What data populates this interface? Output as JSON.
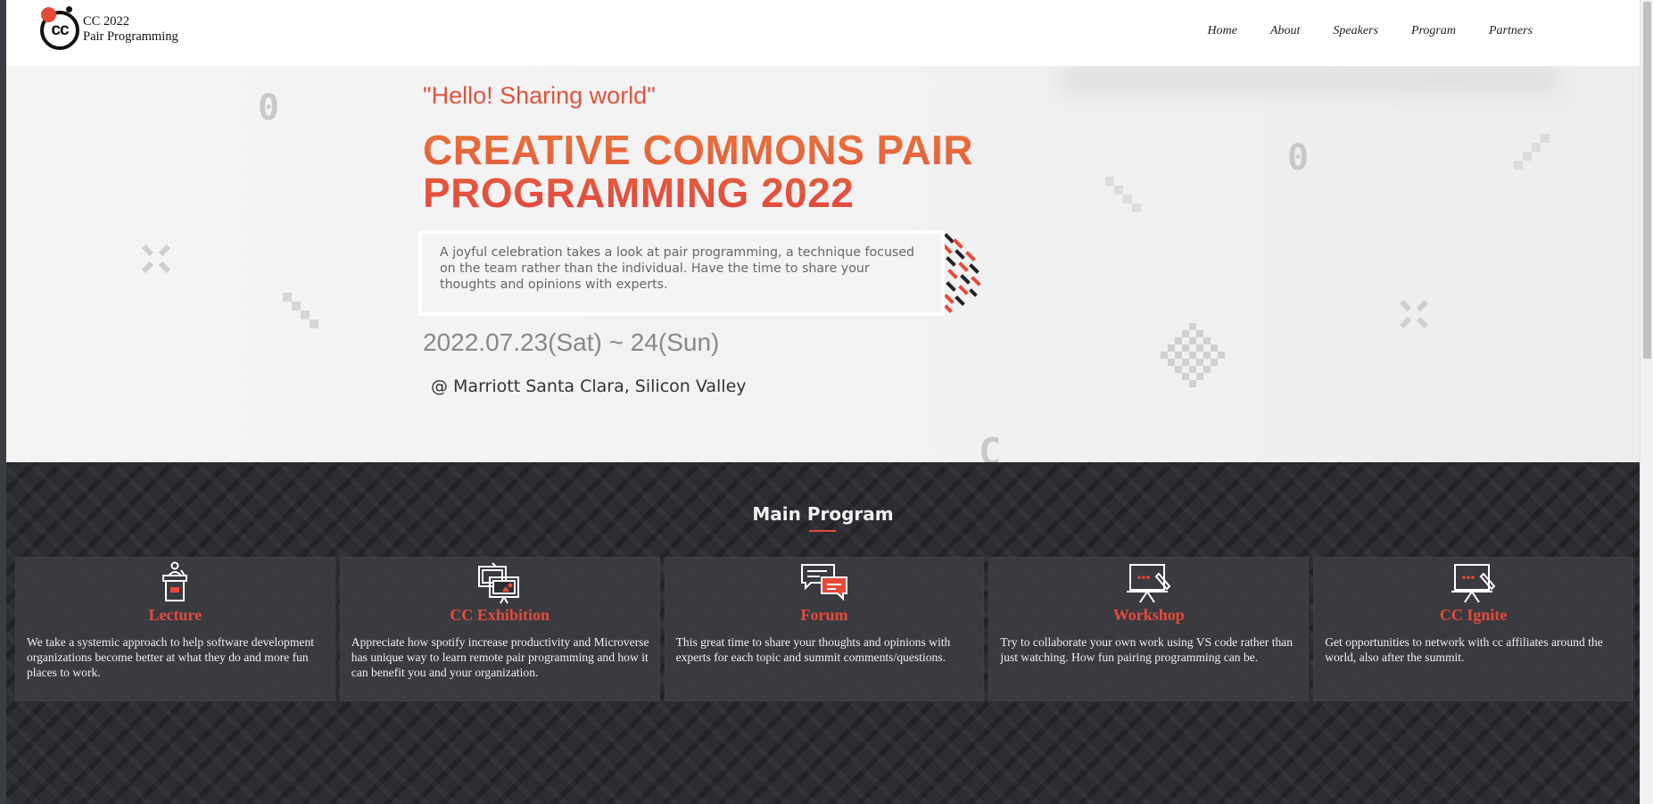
{
  "brand": {
    "line1": "CC 2022",
    "line2": "Pair Programming",
    "logo_text": "cc"
  },
  "nav": {
    "items": [
      "Home",
      "About",
      "Speakers",
      "Program",
      "Partners"
    ]
  },
  "hero": {
    "tagline": "\"Hello! Sharing world\"",
    "title_line1": "CREATIVE COMMONS PAIR",
    "title_line2": "PROGRAMMING 2022",
    "description": "A joyful celebration takes a look at pair programming, a technique focused on the team rather than the individual. Have the time to share your thoughts and opinions with experts.",
    "date": "2022.07.23(Sat) ~ 24(Sun)",
    "venue": "@ Marriott Santa Clara, Silicon Valley"
  },
  "program": {
    "title": "Main Program",
    "cards": [
      {
        "title": "Lecture",
        "text": "We take a systemic approach to help software development organizations become better at what they do and more fun places to work.",
        "icon": "podium-icon"
      },
      {
        "title": "CC Exhibition",
        "text": "Appreciate how spotify increase productivity and Microverse has unique way to learn remote pair programming and how it can benefit you and your organization.",
        "icon": "exhibition-boards-icon"
      },
      {
        "title": "Forum",
        "text": "This great time to share your thoughts and opinions with experts for each topic and summit comments/questions.",
        "icon": "chat-bubbles-icon"
      },
      {
        "title": "Workshop",
        "text": "Try to collaborate your own work using VS code rather than just watching. How fun pairing programming can be.",
        "icon": "easel-pen-icon"
      },
      {
        "title": "CC Ignite",
        "text": "Get opportunities to network with cc affiliates around the world, also after the summit.",
        "icon": "easel-pen-icon"
      }
    ]
  },
  "decor": {
    "zero_glyph": "0",
    "c_glyph": "C"
  },
  "colors": {
    "accent": "#e84a3a",
    "accent_orange": "#e8733a",
    "dark_bg": "#2c2d32",
    "hero_bg": "#f2f2f2"
  }
}
